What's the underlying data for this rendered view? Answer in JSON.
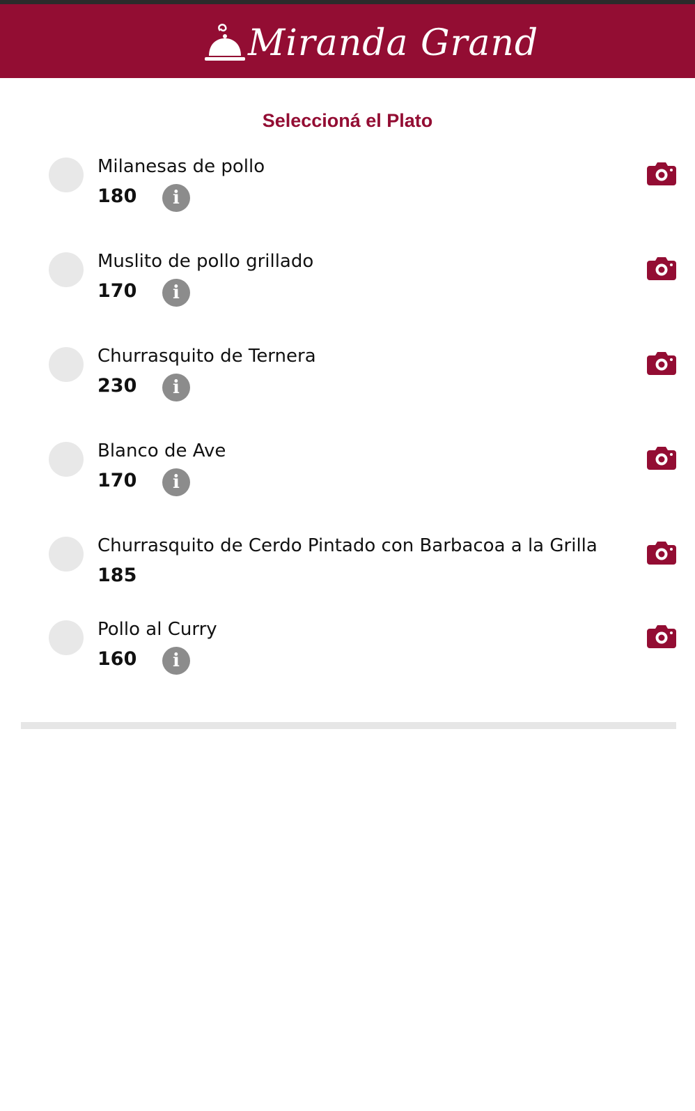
{
  "brand": {
    "name": "Miranda Grand",
    "primary_color": "#930d33",
    "logo_icon": "cloche-icon"
  },
  "page": {
    "title": "Seleccioná el Plato"
  },
  "dishes": [
    {
      "name": "Milanesas de pollo",
      "price": "180",
      "has_info": true
    },
    {
      "name": "Muslito de pollo grillado",
      "price": "170",
      "has_info": true
    },
    {
      "name": "Churrasquito de Ternera",
      "price": "230",
      "has_info": true
    },
    {
      "name": "Blanco de Ave",
      "price": "170",
      "has_info": true
    },
    {
      "name": "Churrasquito de Cerdo Pintado con Barbacoa a la Grilla",
      "price": "185",
      "has_info": false
    },
    {
      "name": "Pollo al Curry",
      "price": "160",
      "has_info": true
    }
  ],
  "icons": {
    "info": "info-icon",
    "camera": "camera-icon",
    "info_glyph": "i"
  }
}
